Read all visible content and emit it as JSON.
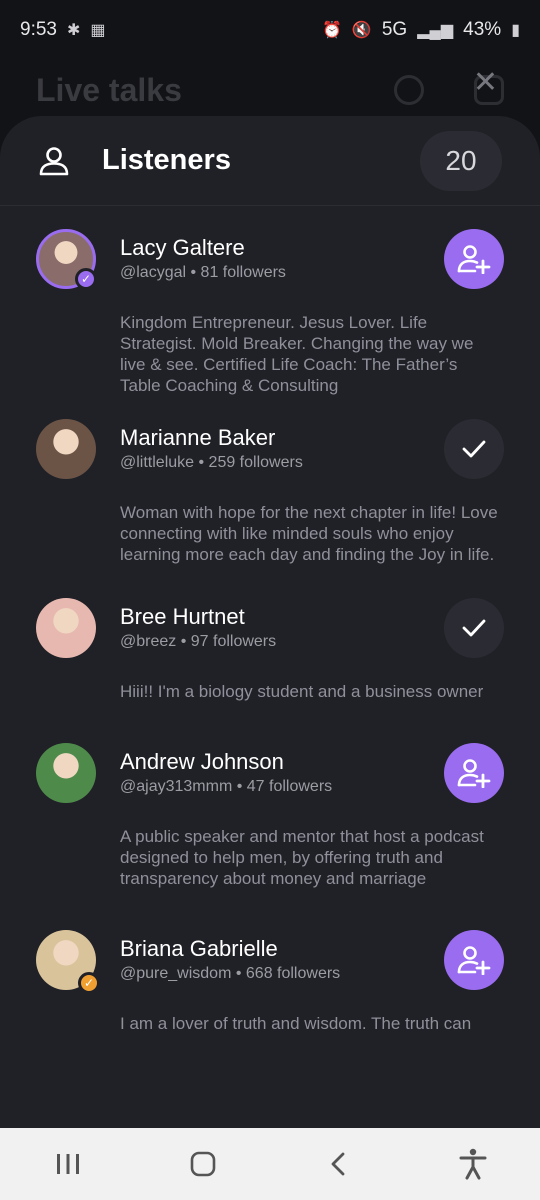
{
  "status_bar": {
    "time": "9:53",
    "network": "5G",
    "battery": "43%"
  },
  "background": {
    "title": "Live talks"
  },
  "sheet": {
    "title": "Listeners",
    "count": "20",
    "listeners": [
      {
        "name": "Lacy Galtere",
        "handle": "@lacygal • 81 followers",
        "bio": "Kingdom Entrepreneur. Jesus Lover. Life Strategist. Mold Breaker. Changing the way we live & see. Certified Life Coach: The Father’s Table Coaching & Consulting",
        "action": "follow",
        "avatar_color": "#8a6d6a",
        "badge_color": "#9a6cf0"
      },
      {
        "name": "Marianne Baker",
        "handle": "@littleluke • 259 followers",
        "bio": "Woman with hope for the next chapter in  life! Love connecting with like minded souls who enjoy learning more each day and finding the Joy in life.",
        "action": "following",
        "avatar_color": "#6b5446"
      },
      {
        "name": "Bree Hurtnet",
        "handle": "@breez • 97 followers",
        "bio": "Hiii!! I'm a biology student and a business owner",
        "action": "following",
        "avatar_color": "#e7b8b0"
      },
      {
        "name": "Andrew Johnson",
        "handle": "@ajay313mmm • 47 followers",
        "bio": "A public speaker and mentor that host a podcast designed to help men, by offering truth and transparency about money and marriage",
        "action": "follow",
        "avatar_color": "#4e8a4a"
      },
      {
        "name": "Briana Gabrielle",
        "handle": "@pure_wisdom • 668 followers",
        "bio": "I am a lover of truth and wisdom. The truth can",
        "action": "follow",
        "avatar_color": "#d9c39a",
        "badge_color": "#f0a030"
      }
    ]
  },
  "icons": {
    "listeners": "person-icon",
    "follow": "add-person-icon",
    "following": "checkmark-icon",
    "close": "close-icon"
  }
}
